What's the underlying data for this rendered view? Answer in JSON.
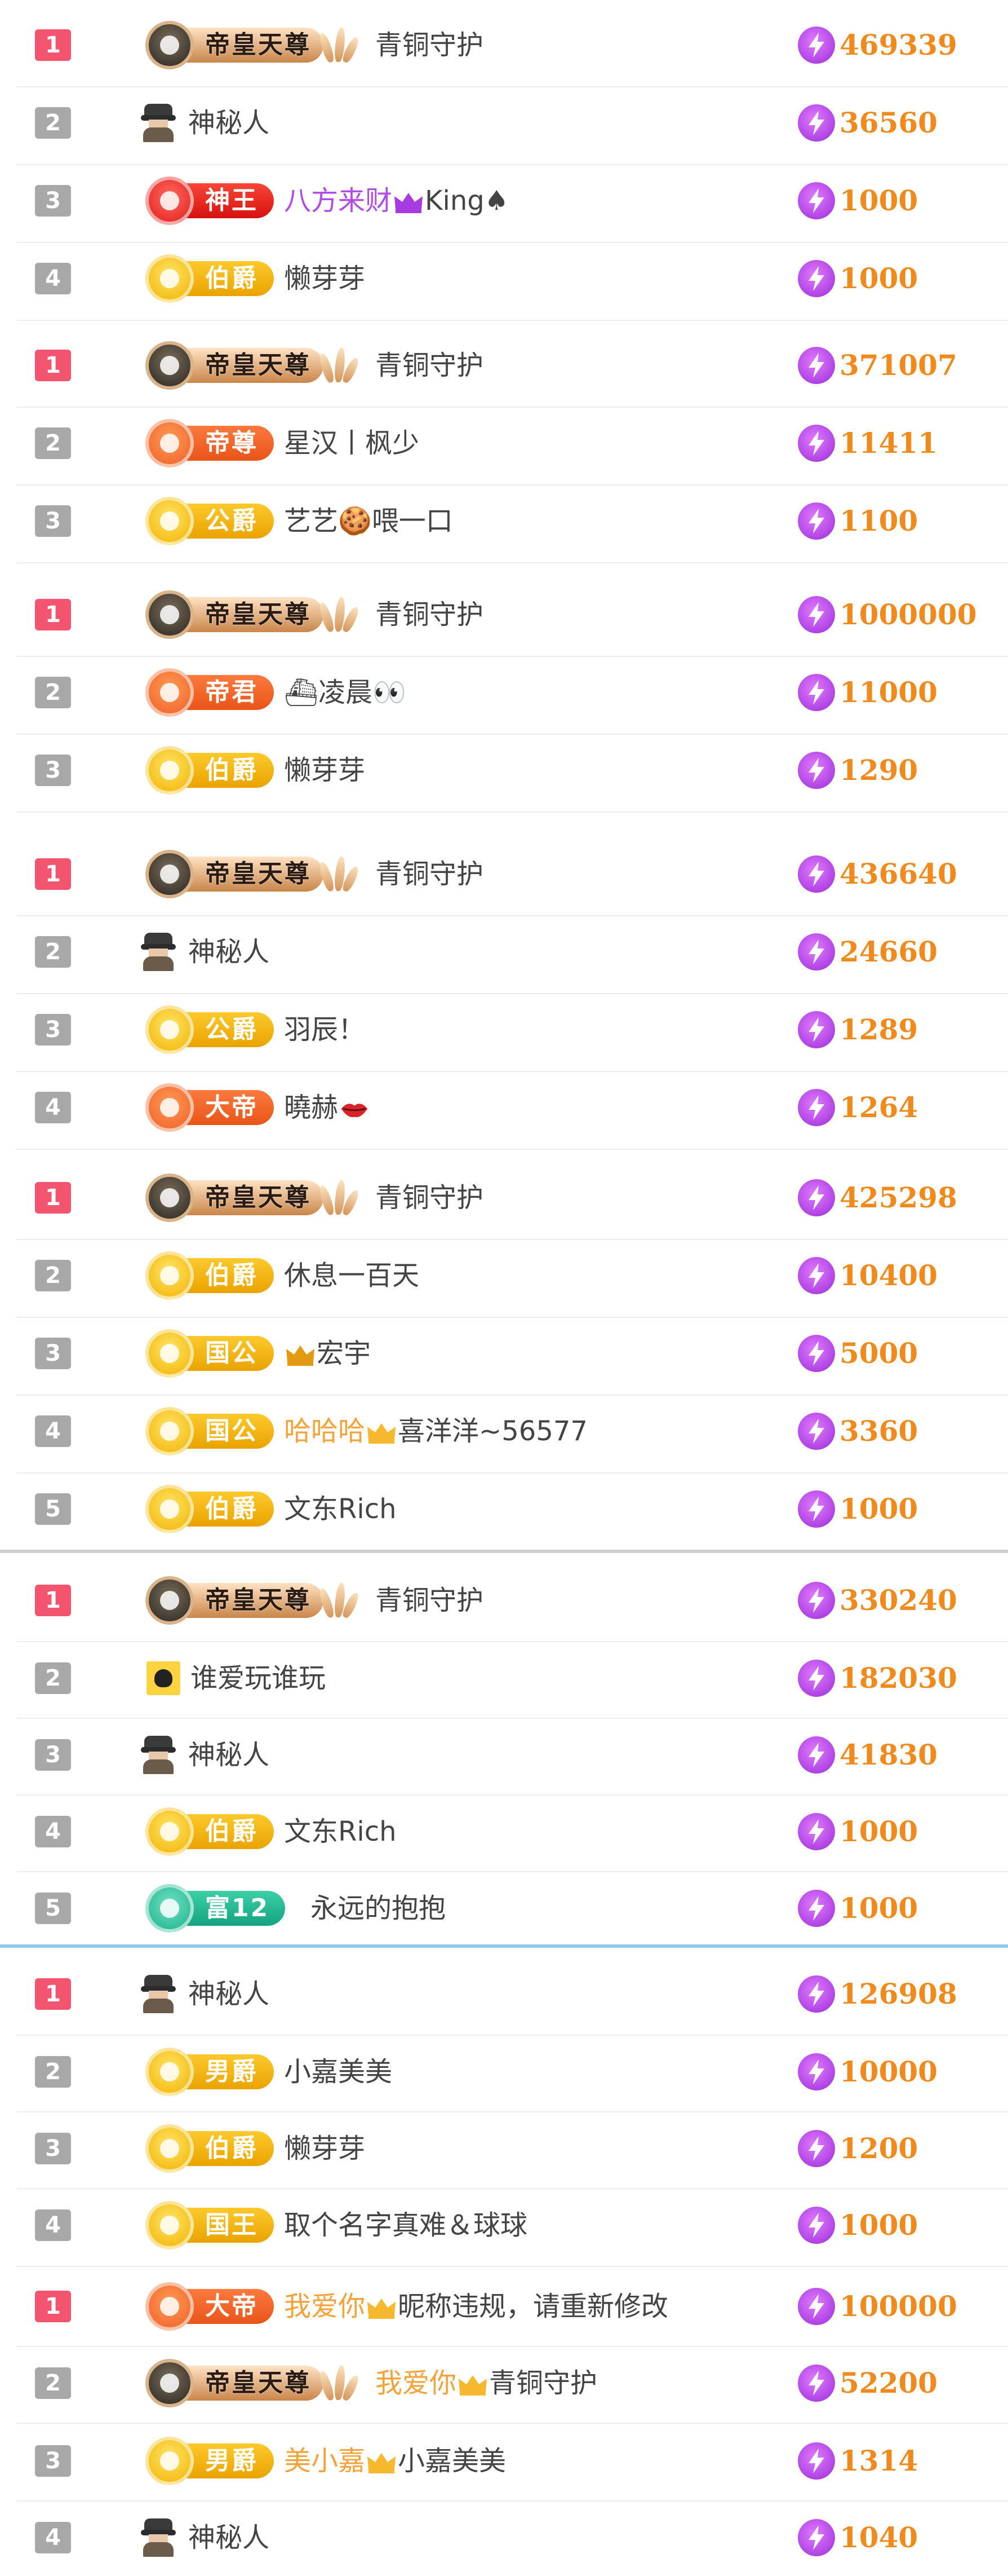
{
  "boards": [
    {
      "rows": [
        {
          "rank": "1",
          "badge": {
            "style": "dark",
            "label": "帝皇天尊",
            "wings": true
          },
          "name_parts": [
            {
              "text": "青铜守护"
            }
          ],
          "score": "469339"
        },
        {
          "rank": "2",
          "avatar": "spy-icon",
          "name_parts": [
            {
              "text": "神秘人"
            }
          ],
          "score": "36560"
        },
        {
          "rank": "3",
          "badge": {
            "style": "red",
            "label": "神王"
          },
          "name_parts": [
            {
              "text": "八方来财",
              "color": "#b24ce8"
            },
            {
              "icon": "crown-purple"
            },
            {
              "text": "King♠"
            }
          ],
          "score": "1000"
        },
        {
          "rank": "4",
          "badge": {
            "style": "gold",
            "label": "伯爵"
          },
          "name_parts": [
            {
              "text": "懒芽芽"
            }
          ],
          "score": "1000"
        }
      ]
    },
    {
      "rows": [
        {
          "rank": "1",
          "badge": {
            "style": "dark",
            "label": "帝皇天尊",
            "wings": true
          },
          "name_parts": [
            {
              "text": "青铜守护"
            }
          ],
          "score": "371007"
        },
        {
          "rank": "2",
          "badge": {
            "style": "orange",
            "label": "帝尊"
          },
          "name_parts": [
            {
              "text": "星汉丨枫少"
            }
          ],
          "score": "11411"
        },
        {
          "rank": "3",
          "badge": {
            "style": "gold",
            "label": "公爵"
          },
          "name_parts": [
            {
              "text": "艺艺🍪喂一口"
            }
          ],
          "score": "1100"
        }
      ]
    },
    {
      "rows": [
        {
          "rank": "1",
          "badge": {
            "style": "dark",
            "label": "帝皇天尊",
            "wings": true
          },
          "name_parts": [
            {
              "text": "青铜守护"
            }
          ],
          "score": "1000000"
        },
        {
          "rank": "2",
          "badge": {
            "style": "orange",
            "label": "帝君"
          },
          "name_parts": [
            {
              "text": "⛴凌晨👀"
            }
          ],
          "score": "11000"
        },
        {
          "rank": "3",
          "badge": {
            "style": "gold",
            "label": "伯爵"
          },
          "name_parts": [
            {
              "text": "懒芽芽"
            }
          ],
          "score": "1290"
        }
      ]
    },
    {
      "rows": [
        {
          "rank": "1",
          "badge": {
            "style": "dark",
            "label": "帝皇天尊",
            "wings": true
          },
          "name_parts": [
            {
              "text": "青铜守护"
            }
          ],
          "score": "436640"
        },
        {
          "rank": "2",
          "avatar": "spy-icon",
          "name_parts": [
            {
              "text": "神秘人"
            }
          ],
          "score": "24660"
        },
        {
          "rank": "3",
          "badge": {
            "style": "gold",
            "label": "公爵"
          },
          "name_parts": [
            {
              "text": "羽辰！"
            }
          ],
          "score": "1289"
        },
        {
          "rank": "4",
          "badge": {
            "style": "orange",
            "label": "大帝"
          },
          "name_parts": [
            {
              "text": "曉赫"
            },
            {
              "icon": "lips-red"
            }
          ],
          "score": "1264"
        }
      ]
    },
    {
      "rows": [
        {
          "rank": "1",
          "badge": {
            "style": "dark",
            "label": "帝皇天尊",
            "wings": true
          },
          "name_parts": [
            {
              "text": "青铜守护"
            }
          ],
          "score": "425298"
        },
        {
          "rank": "2",
          "badge": {
            "style": "gold",
            "label": "伯爵"
          },
          "name_parts": [
            {
              "text": "休息一百天"
            }
          ],
          "score": "10400"
        },
        {
          "rank": "3",
          "badge": {
            "style": "gold",
            "label": "国公"
          },
          "name_parts": [
            {
              "icon": "crown-gold-small"
            },
            {
              "text": "宏宇"
            }
          ],
          "score": "5000"
        },
        {
          "rank": "4",
          "badge": {
            "style": "gold",
            "label": "国公"
          },
          "name_parts": [
            {
              "text": "哈哈哈",
              "color": "#f4a33a"
            },
            {
              "icon": "crown-gold"
            },
            {
              "text": "喜洋洋~56577"
            }
          ],
          "score": "3360"
        },
        {
          "rank": "5",
          "badge": {
            "style": "gold",
            "label": "伯爵"
          },
          "name_parts": [
            {
              "text": "文东Rich"
            }
          ],
          "score": "1000"
        }
      ]
    },
    {
      "rows": [
        {
          "rank": "1",
          "badge": {
            "style": "dark",
            "label": "帝皇天尊",
            "wings": true
          },
          "name_parts": [
            {
              "text": "青铜守护"
            }
          ],
          "score": "330240"
        },
        {
          "rank": "2",
          "avatar": "bat-avatar-icon",
          "name_parts": [
            {
              "text": "谁爱玩谁玩"
            }
          ],
          "score": "182030"
        },
        {
          "rank": "3",
          "avatar": "spy-icon",
          "name_parts": [
            {
              "text": "神秘人"
            }
          ],
          "score": "41830"
        },
        {
          "rank": "4",
          "badge": {
            "style": "gold",
            "label": "伯爵"
          },
          "name_parts": [
            {
              "text": "文东Rich"
            }
          ],
          "score": "1000"
        },
        {
          "rank": "5",
          "badge": {
            "style": "teal",
            "label": "富12"
          },
          "name_parts": [
            {
              "text": "永远的抱抱"
            }
          ],
          "score": "1000"
        }
      ]
    },
    {
      "rows": [
        {
          "rank": "1",
          "avatar": "spy-icon",
          "name_parts": [
            {
              "text": "神秘人"
            }
          ],
          "score": "126908"
        },
        {
          "rank": "2",
          "badge": {
            "style": "gold",
            "label": "男爵"
          },
          "name_parts": [
            {
              "text": "小嘉美美"
            }
          ],
          "score": "10000"
        },
        {
          "rank": "3",
          "badge": {
            "style": "gold",
            "label": "伯爵"
          },
          "name_parts": [
            {
              "text": "懒芽芽"
            }
          ],
          "score": "1200"
        },
        {
          "rank": "4",
          "badge": {
            "style": "gold",
            "label": "国王"
          },
          "name_parts": [
            {
              "text": "取个名字真难＆球球"
            }
          ],
          "score": "1000"
        }
      ]
    },
    {
      "rows": [
        {
          "rank": "1",
          "badge": {
            "style": "orange",
            "label": "大帝"
          },
          "name_parts": [
            {
              "text": "我爱你",
              "color": "#f4a33a"
            },
            {
              "icon": "crown-gold"
            },
            {
              "text": "昵称违规，请重新修改"
            }
          ],
          "score": "100000"
        },
        {
          "rank": "2",
          "badge": {
            "style": "dark",
            "label": "帝皇天尊",
            "wings": true
          },
          "name_parts": [
            {
              "text": "我爱你",
              "color": "#f4a33a"
            },
            {
              "icon": "crown-gold"
            },
            {
              "text": "青铜守护"
            }
          ],
          "score": "52200"
        },
        {
          "rank": "3",
          "badge": {
            "style": "gold",
            "label": "男爵"
          },
          "name_parts": [
            {
              "text": "美小嘉",
              "color": "#f4a33a"
            },
            {
              "icon": "crown-gold"
            },
            {
              "text": "小嘉美美"
            }
          ],
          "score": "1314"
        },
        {
          "rank": "4",
          "avatar": "spy-icon",
          "name_parts": [
            {
              "text": "神秘人"
            }
          ],
          "score": "1040"
        }
      ]
    }
  ]
}
